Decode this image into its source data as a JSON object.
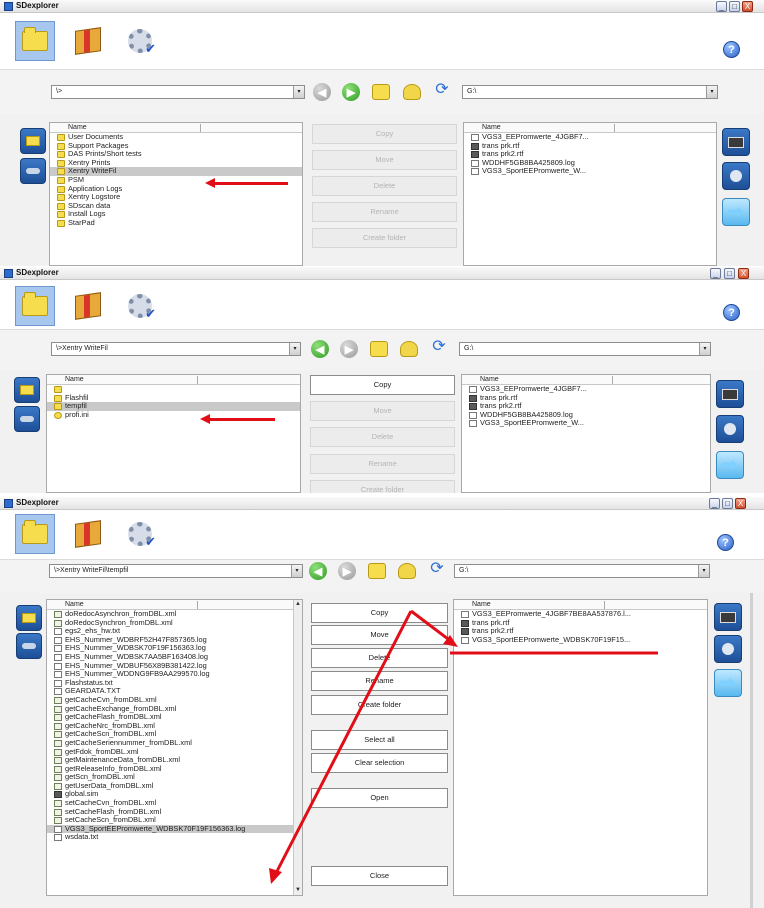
{
  "app_title": "SDexplorer",
  "win_buttons": {
    "min": "_",
    "max": "□",
    "close": "X"
  },
  "help_label": "?",
  "combo_arrow": "▾",
  "window1": {
    "left_path": "\\>",
    "right_path": "G:\\",
    "left_header": "Name",
    "right_header": "Name",
    "left_items": [
      {
        "name": "User Documents",
        "type": "folder"
      },
      {
        "name": "Support Packages",
        "type": "folder"
      },
      {
        "name": "DAS Prints/Short tests",
        "type": "folder"
      },
      {
        "name": "Xentry Prints",
        "type": "folder"
      },
      {
        "name": "Xentry WriteFil",
        "type": "folder",
        "selected": true
      },
      {
        "name": "PSM",
        "type": "folder"
      },
      {
        "name": "Application Logs",
        "type": "folder"
      },
      {
        "name": "Xentry Logstore",
        "type": "folder"
      },
      {
        "name": "SDscan data",
        "type": "folder"
      },
      {
        "name": "Install Logs",
        "type": "folder"
      },
      {
        "name": "StarPad",
        "type": "folder"
      }
    ],
    "right_items": [
      {
        "name": "VGS3_EEPromwerte_4JGBF7...",
        "type": "doc"
      },
      {
        "name": "trans prk.rtf",
        "type": "rtf"
      },
      {
        "name": "trans prk2.rtf",
        "type": "rtf"
      },
      {
        "name": "WDDHF5GB8BA425809.log",
        "type": "doc"
      },
      {
        "name": "VGS3_SportEEPromwerte_W...",
        "type": "doc"
      }
    ],
    "actions": [
      "Copy",
      "Move",
      "Delete",
      "Rename",
      "Create folder"
    ]
  },
  "window2": {
    "left_path": "\\>Xentry WriteFil",
    "right_path": "G:\\",
    "left_header": "Name",
    "right_header": "Name",
    "left_items": [
      {
        "name": "",
        "type": "folder"
      },
      {
        "name": "Flashfil",
        "type": "folder"
      },
      {
        "name": "tempfil",
        "type": "folder",
        "selected": true
      },
      {
        "name": "profi.ini",
        "type": "ini"
      }
    ],
    "right_items": [
      {
        "name": "VGS3_EEPromwerte_4JGBF7...",
        "type": "doc"
      },
      {
        "name": "trans prk.rtf",
        "type": "rtf"
      },
      {
        "name": "trans prk2.rtf",
        "type": "rtf"
      },
      {
        "name": "WDDHF5GB8BA425809.log",
        "type": "doc"
      },
      {
        "name": "VGS3_SportEEPromwerte_W...",
        "type": "doc"
      }
    ],
    "actions": [
      "Copy",
      "Move",
      "Delete",
      "Rename",
      "Create folder"
    ]
  },
  "window3": {
    "left_path": "\\>Xentry WriteFil\\tempfil",
    "right_path": "G:\\",
    "left_header": "Name",
    "right_header": "Name",
    "left_items": [
      {
        "name": "doRedocAsynchron_fromDBL.xml",
        "type": "xml"
      },
      {
        "name": "doRedocSynchron_fromDBL.xml",
        "type": "xml"
      },
      {
        "name": "egs2_ehs_hw.txt",
        "type": "doc"
      },
      {
        "name": "EHS_Nummer_WDBRF52H47F857365.log",
        "type": "doc"
      },
      {
        "name": "EHS_Nummer_WDBSK70F19F156363.log",
        "type": "doc"
      },
      {
        "name": "EHS_Nummer_WDBSK7AA5BF163408.log",
        "type": "doc"
      },
      {
        "name": "EHS_Nummer_WDBUF56X89B381422.log",
        "type": "doc"
      },
      {
        "name": "EHS_Nummer_WDDNG9FB9AA299570.log",
        "type": "doc"
      },
      {
        "name": "Flashstatus.txt",
        "type": "doc"
      },
      {
        "name": "GEARDATA.TXT",
        "type": "doc"
      },
      {
        "name": "getCacheCvn_fromDBL.xml",
        "type": "xml"
      },
      {
        "name": "getCacheExchange_fromDBL.xml",
        "type": "xml"
      },
      {
        "name": "getCacheFlash_fromDBL.xml",
        "type": "xml"
      },
      {
        "name": "getCacheNrc_fromDBL.xml",
        "type": "xml"
      },
      {
        "name": "getCacheScn_fromDBL.xml",
        "type": "xml"
      },
      {
        "name": "getCacheSeriennummer_fromDBL.xml",
        "type": "xml"
      },
      {
        "name": "getFdok_fromDBL.xml",
        "type": "xml"
      },
      {
        "name": "getMaintenanceData_fromDBL.xml",
        "type": "xml"
      },
      {
        "name": "getReleaseInfo_fromDBL.xml",
        "type": "xml"
      },
      {
        "name": "getScn_fromDBL.xml",
        "type": "xml"
      },
      {
        "name": "getUserData_fromDBL.xml",
        "type": "xml"
      },
      {
        "name": "global.sim",
        "type": "rtf"
      },
      {
        "name": "setCacheCvn_fromDBL.xml",
        "type": "xml"
      },
      {
        "name": "setCacheFlash_fromDBL.xml",
        "type": "xml"
      },
      {
        "name": "setCacheScn_fromDBL.xml",
        "type": "xml"
      },
      {
        "name": "VGS3_SportEEPromwerte_WDBSK70F19F156363.log",
        "type": "doc",
        "selected": true
      },
      {
        "name": "wsdata.txt",
        "type": "doc"
      }
    ],
    "right_items": [
      {
        "name": "VGS3_EEPromwerte_4JGBF7BE8AA537876.l...",
        "type": "doc"
      },
      {
        "name": "trans prk.rtf",
        "type": "rtf"
      },
      {
        "name": "trans prk2.rtf",
        "type": "rtf"
      },
      {
        "name": "VGS3_SportEEPromwerte_WDBSK70F19F15...",
        "type": "doc"
      }
    ],
    "actions": [
      "Copy",
      "Move",
      "Delete",
      "Rename",
      "Create folder"
    ],
    "extra_actions": [
      "Select all",
      "Clear selection",
      "Open"
    ],
    "close_label": "Close"
  },
  "scroll_arrows": {
    "up": "▲",
    "down": "▼"
  },
  "colors": {
    "annotation_red": "#e10e17",
    "selection_blue": "#a7c7ef"
  },
  "icons": {
    "toolbar": [
      "folder-icon",
      "package-icon",
      "gear-check-icon"
    ],
    "nav": [
      "back-icon",
      "forward-icon",
      "up-folder-icon",
      "new-folder-icon",
      "refresh-icon"
    ],
    "side": [
      "local-drive-icon",
      "network-drive-icon"
    ],
    "right_side": [
      "monitor-icon",
      "globe-icon",
      "transfer-icon"
    ]
  }
}
